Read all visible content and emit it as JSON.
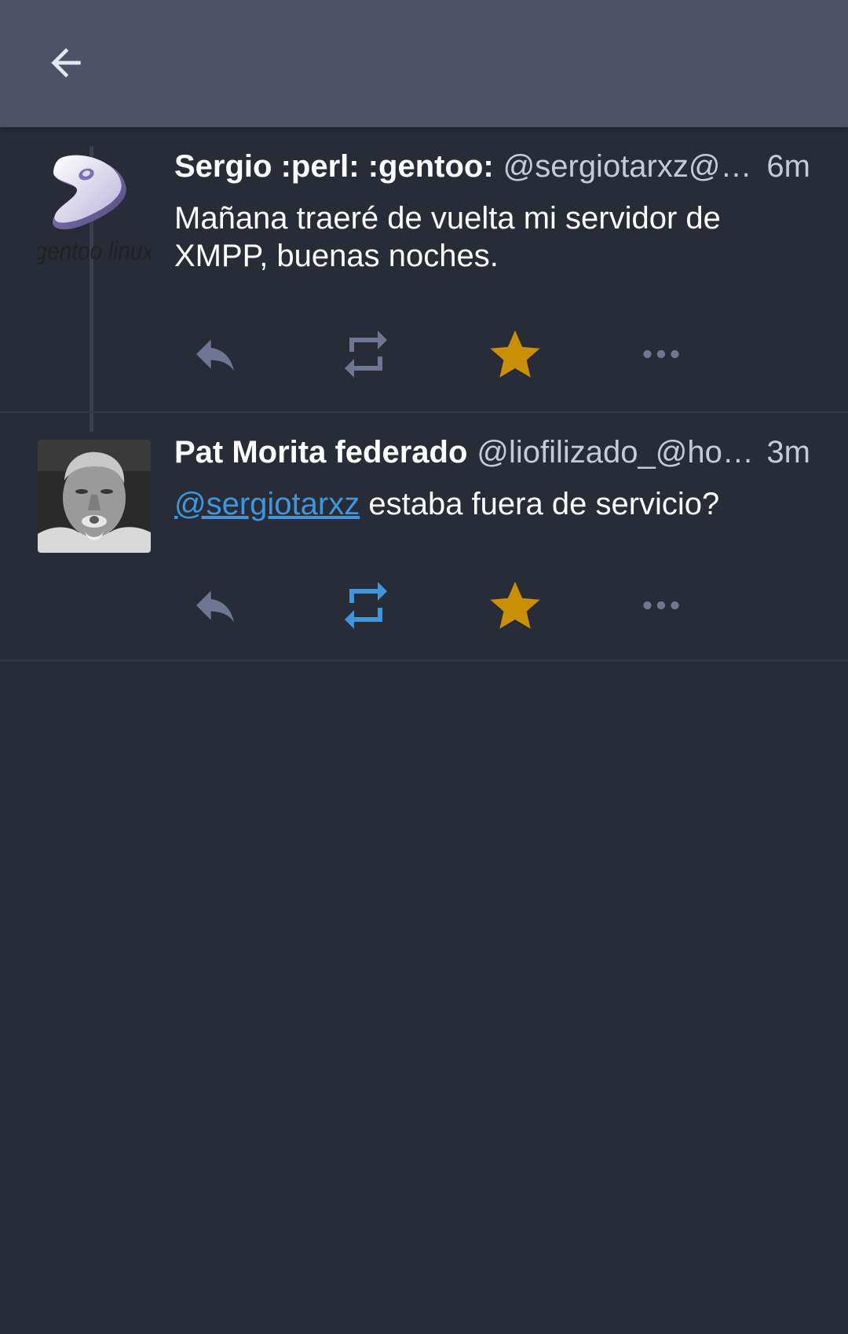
{
  "colors": {
    "background": "#282c37",
    "appbar": "#4d5269",
    "accent_blue": "#3d96de",
    "favourite": "#ca8f04",
    "icon_muted": "#6d7692"
  },
  "appbar": {
    "back_icon": "arrow-left-icon"
  },
  "statuses": [
    {
      "display_name": "Sergio :perl: :gentoo:",
      "acct": "@sergiotarxz@…",
      "time": "6m",
      "avatar_text": "gentoo linux",
      "content": "Mañana traeré de vuelta mi servidor de XMPP, buenas noches.",
      "reblogged": false,
      "favourited": true
    },
    {
      "display_name": "Pat Morita federado",
      "acct": "@liofilizado_@ho…",
      "time": "3m",
      "mention": "@sergiotarxz",
      "content": " estaba fuera de servicio?",
      "reblogged": true,
      "favourited": true
    }
  ]
}
